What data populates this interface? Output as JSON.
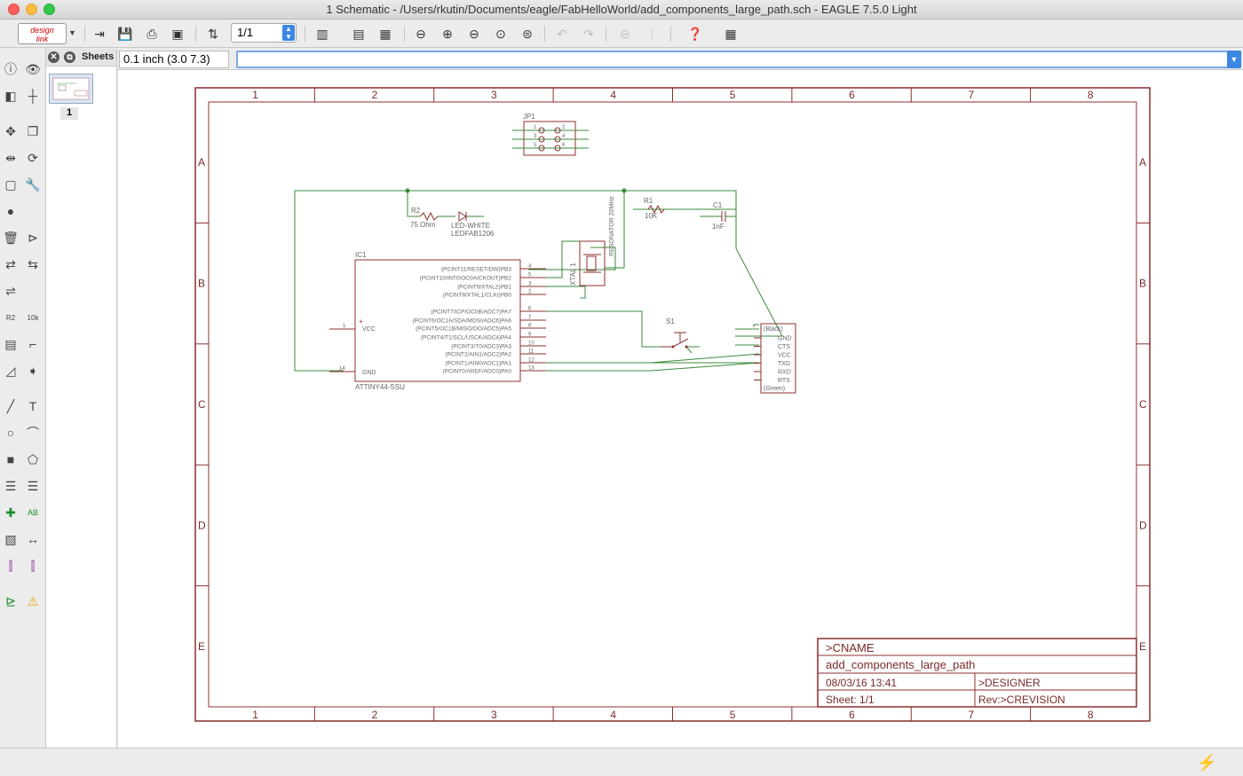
{
  "window": {
    "title": "1 Schematic - /Users/rkutin/Documents/eagle/FabHelloWorld/add_components_large_path.sch - EAGLE 7.5.0 Light"
  },
  "toolbar": {
    "logo_line1": "design",
    "logo_line2": "link",
    "sheet_value": "1/1"
  },
  "sheets_panel": {
    "title": "Sheets",
    "thumb_number": "1"
  },
  "coord": {
    "readout": "0.1 inch (3.0 7.3)"
  },
  "frame": {
    "columns": [
      "1",
      "2",
      "3",
      "4",
      "5",
      "6",
      "7",
      "8"
    ],
    "rows": [
      "A",
      "B",
      "C",
      "D",
      "E"
    ]
  },
  "titleblock": {
    "cname": ">CNAME",
    "filename": "add_components_large_path",
    "date": "08/03/16 13:41",
    "designer": ">DESIGNER",
    "sheet": "Sheet: 1/1",
    "rev": "Rev:>CREVISION"
  },
  "schematic": {
    "jp1": "JP1",
    "r2_name": "R2",
    "r2_value": "75 Ohm",
    "led_name": "LED-WHITE",
    "led_value": "LEDFAB1206",
    "r1_name": "R1",
    "r1_value": "10K",
    "c1_name": "C1",
    "c1_value": "1nF",
    "xtal_name": "XTAL 1",
    "xtal_value": "RESONATOR 20MHz",
    "ic_name": "IC1",
    "ic_value": "ATTINY44-SSU",
    "vcc": "VCC",
    "gnd": "GND",
    "s1": "S1",
    "ic_pins_right": [
      {
        "label": "(PCINT11/RESET/DW)PB3",
        "num": "4"
      },
      {
        "label": "(PCINT10/INT0/OC0A/CKOUT)PB2",
        "num": "5"
      },
      {
        "label": "(PCINT9/XTAL2)PB1",
        "num": "3"
      },
      {
        "label": "(PCINT8/XTAL1/CLKI)PB0",
        "num": "2"
      },
      {
        "label": "(PCINT7/ICP/OC0B/ADC7)PA7",
        "num": "6"
      },
      {
        "label": "(PCINT6/OC1A/SDA/MOSI/ADC6)PA6",
        "num": "7"
      },
      {
        "label": "(PCINT5/OC1B/MISO/DO/ADC5)PA5",
        "num": "8"
      },
      {
        "label": "(PCINT4/T1/SCL/USCK/ADC4)PA4",
        "num": "9"
      },
      {
        "label": "(PCINT3/T0/ADC3)PA3",
        "num": "10"
      },
      {
        "label": "(PCINT2/AIN1/ADC2)PA2",
        "num": "11"
      },
      {
        "label": "(PCINT1/AIN0/ADC1)PA1",
        "num": "12"
      },
      {
        "label": "(PCINT0/AREF/ADC0)PA0",
        "num": "13"
      }
    ],
    "vcc_pin": "1",
    "gnd_pin": "14",
    "ftdi_top": "(Black)",
    "ftdi_bottom": "(Green)",
    "ftdi_pins": [
      "GND",
      "CTS",
      "VCC",
      "TXD",
      "RXD",
      "RTS"
    ],
    "jp1_pins_left": [
      "1",
      "3",
      "5"
    ],
    "jp1_pins_right": [
      "2",
      "4",
      "6"
    ]
  }
}
